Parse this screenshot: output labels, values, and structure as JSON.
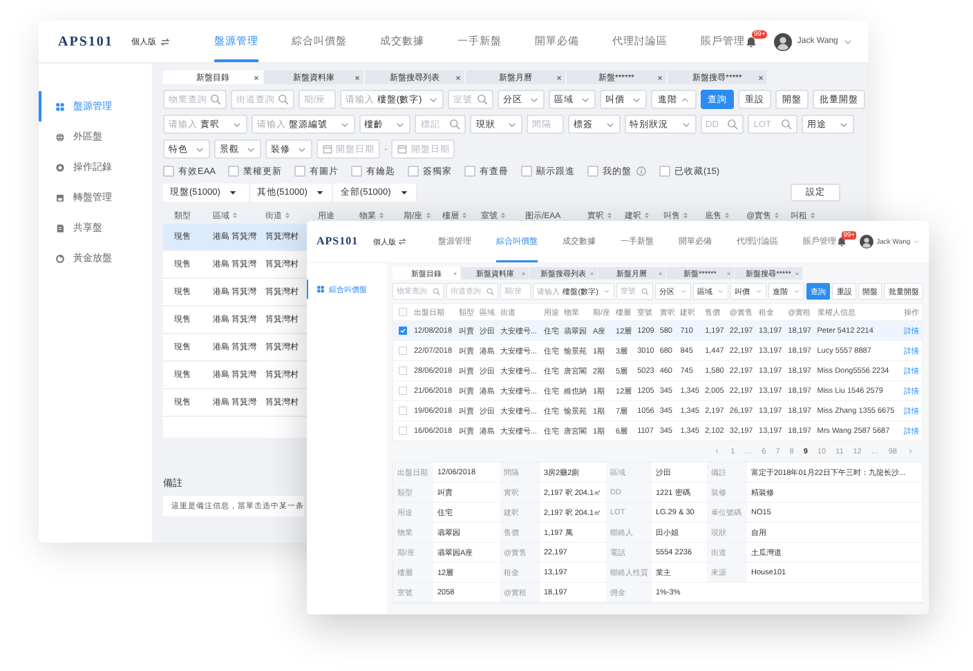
{
  "back_window": {
    "logo": "APS101",
    "edition": "個人版",
    "nav": [
      {
        "label": "盤源管理",
        "selected": true
      },
      {
        "label": "綜合叫價盤",
        "selected": false
      },
      {
        "label": "成交數據",
        "selected": false
      },
      {
        "label": "一手新盤",
        "selected": false
      },
      {
        "label": "開單必備",
        "selected": false
      },
      {
        "label": "代理討論區",
        "selected": false
      },
      {
        "label": "賬戶管理",
        "selected": false
      }
    ],
    "notification_badge": "99+",
    "user": "Jack Wang",
    "sidebar": [
      {
        "label": "盤源管理",
        "selected": true
      },
      {
        "label": "外區盤",
        "selected": false
      },
      {
        "label": "操作記錄",
        "selected": false
      },
      {
        "label": "轉盤管理",
        "selected": false
      },
      {
        "label": "共享盤",
        "selected": false
      },
      {
        "label": "黃金放盤",
        "selected": false
      }
    ],
    "tabs": [
      {
        "label": "新盤目錄",
        "selected": true
      },
      {
        "label": "新盤資料庫",
        "selected": false
      },
      {
        "label": "新盤搜尋列表",
        "selected": false
      },
      {
        "label": "新盤月曆",
        "selected": false
      },
      {
        "label": "新盤******",
        "selected": false
      },
      {
        "label": "新盤搜尋*****",
        "selected": false
      }
    ],
    "filters": [
      [
        {
          "kind": "search",
          "placeholder": "物業查詢"
        },
        {
          "kind": "search",
          "placeholder": "街道查詢"
        },
        {
          "kind": "input",
          "placeholder": "期/座"
        },
        {
          "kind": "select",
          "prefix": "请输入",
          "value": "樓盤(數字)"
        },
        {
          "kind": "search",
          "placeholder": "室號"
        },
        {
          "kind": "select",
          "value": "分区"
        },
        {
          "kind": "select",
          "value": "區域"
        },
        {
          "kind": "select",
          "value": "叫價"
        },
        {
          "kind": "advanced",
          "label": "進階"
        },
        {
          "kind": "button",
          "label": "查詢",
          "primary": true
        },
        {
          "kind": "button",
          "label": "重設",
          "primary": false
        },
        {
          "kind": "button",
          "label": "開盤",
          "primary": false
        },
        {
          "kind": "button",
          "label": "批量開盤",
          "primary": false
        }
      ],
      [
        {
          "kind": "select",
          "prefix": "请输入",
          "value": "實呎"
        },
        {
          "kind": "select",
          "prefix": "请输入",
          "value": "盤源編號"
        },
        {
          "kind": "select",
          "value": "樓齡"
        },
        {
          "kind": "search",
          "placeholder": "標記"
        },
        {
          "kind": "select",
          "value": "現狀"
        },
        {
          "kind": "input",
          "placeholder": "間隔"
        },
        {
          "kind": "select",
          "value": "標簽"
        },
        {
          "kind": "select",
          "value": "特别狀況"
        },
        {
          "kind": "search",
          "placeholder": "DD"
        },
        {
          "kind": "search",
          "placeholder": "LOT"
        },
        {
          "kind": "select",
          "value": "用途"
        }
      ],
      [
        {
          "kind": "select",
          "value": "特色"
        },
        {
          "kind": "select",
          "value": "景觀"
        },
        {
          "kind": "select",
          "value": "裝修"
        },
        {
          "kind": "date",
          "placeholder": "開盤日期"
        },
        {
          "kind": "separator",
          "text": "-"
        },
        {
          "kind": "date",
          "placeholder": "開盤日期"
        }
      ]
    ],
    "checkboxes": [
      {
        "label": "有效EAA",
        "checked": false
      },
      {
        "label": "業權更新",
        "checked": false
      },
      {
        "label": "有圖片",
        "checked": false
      },
      {
        "label": "有鑰匙",
        "checked": false
      },
      {
        "label": "簽獨家",
        "checked": false
      },
      {
        "label": "有查冊",
        "checked": false
      },
      {
        "label": "顯示跟進",
        "checked": false
      },
      {
        "label": "我的盤",
        "checked": false,
        "info": true
      },
      {
        "label": "已收藏(15)",
        "checked": false
      }
    ],
    "segments": [
      "現盤(51000)",
      "其他(51000)",
      "全部(51000)"
    ],
    "settings_button": "設定",
    "table": {
      "columns": [
        {
          "label": "類型",
          "sortable": false
        },
        {
          "label": "區域",
          "sortable": true
        },
        {
          "label": "街道",
          "sortable": true
        },
        {
          "label": "用途",
          "sortable": false
        },
        {
          "label": "物業",
          "sortable": true
        },
        {
          "label": "期/座",
          "sortable": true
        },
        {
          "label": "樓層",
          "sortable": true
        },
        {
          "label": "室號",
          "sortable": true
        },
        {
          "label": "图示/EAA",
          "sortable": false
        },
        {
          "label": "實呎",
          "sortable": true
        },
        {
          "label": "建呎",
          "sortable": true
        },
        {
          "label": "叫售",
          "sortable": true
        },
        {
          "label": "底售",
          "sortable": true
        },
        {
          "label": "@實售",
          "sortable": true
        },
        {
          "label": "叫租",
          "sortable": true
        }
      ],
      "rows": [
        {
          "selected": true,
          "cells": [
            "現售",
            "港島 筲箕灣",
            "筲箕灣村"
          ]
        },
        {
          "selected": false,
          "cells": [
            "現售",
            "港島 筲箕灣",
            "筲箕灣村"
          ]
        },
        {
          "selected": false,
          "cells": [
            "現售",
            "港島 筲箕灣",
            "筲箕灣村"
          ]
        },
        {
          "selected": false,
          "cells": [
            "現售",
            "港島 筲箕灣",
            "筲箕灣村"
          ]
        },
        {
          "selected": false,
          "cells": [
            "現售",
            "港島 筲箕灣",
            "筲箕灣村"
          ]
        },
        {
          "selected": false,
          "cells": [
            "現售",
            "港島 筲箕灣",
            "筲箕灣村"
          ]
        },
        {
          "selected": false,
          "cells": [
            "現售",
            "港島 筲箕灣",
            "筲箕灣村"
          ]
        }
      ]
    },
    "note": {
      "title": "備註",
      "text": "這里是備注信息，當單击选中某一条"
    }
  },
  "front_window": {
    "logo": "APS101",
    "edition": "個人版",
    "nav": [
      {
        "label": "盤源管理",
        "selected": false
      },
      {
        "label": "綜合叫價盤",
        "selected": true
      },
      {
        "label": "成交數據",
        "selected": false
      },
      {
        "label": "一手新盤",
        "selected": false
      },
      {
        "label": "開單必備",
        "selected": false
      },
      {
        "label": "代理討論區",
        "selected": false
      },
      {
        "label": "賬戶管理",
        "selected": false
      }
    ],
    "notification_badge": "99+",
    "user": "Jack Wang",
    "sidebar": [
      {
        "label": "綜合叫價盤",
        "selected": true
      }
    ],
    "tabs": [
      {
        "label": "新盤目錄",
        "selected": true
      },
      {
        "label": "新盤資料庫",
        "selected": false
      },
      {
        "label": "新盤搜尋列表",
        "selected": false
      },
      {
        "label": "新盤月曆",
        "selected": false
      },
      {
        "label": "新盤******",
        "selected": false
      },
      {
        "label": "新盤搜尋*****",
        "selected": false
      }
    ],
    "filters": [
      [
        {
          "kind": "search",
          "placeholder": "物業查詢"
        },
        {
          "kind": "search",
          "placeholder": "街道查詢"
        },
        {
          "kind": "input",
          "placeholder": "期/座"
        },
        {
          "kind": "select",
          "prefix": "请输入",
          "value": "樓盤(數字)"
        },
        {
          "kind": "search",
          "placeholder": "室號"
        },
        {
          "kind": "select",
          "value": "分区"
        },
        {
          "kind": "select",
          "value": "區域"
        },
        {
          "kind": "select",
          "value": "叫價"
        },
        {
          "kind": "select",
          "value": "進階"
        },
        {
          "kind": "button",
          "label": "查詢",
          "primary": true
        },
        {
          "kind": "button",
          "label": "重設",
          "primary": false
        },
        {
          "kind": "button",
          "label": "開盤",
          "primary": false
        },
        {
          "kind": "button",
          "label": "批量開盤",
          "primary": false
        }
      ]
    ],
    "table": {
      "select_all": {
        "checked": false
      },
      "columns": [
        "出盤日期",
        "類型",
        "區域",
        "街道",
        "用途",
        "物業",
        "期/座",
        "樓層",
        "室號",
        "實呎",
        "建呎",
        "售價",
        "@實售",
        "租金",
        "@實租",
        "業權人信息",
        "操作"
      ],
      "rows": [
        {
          "checked": true,
          "cells": [
            "12/08/2018",
            "叫賣",
            "沙田",
            "大安樓号...",
            "住宅",
            "翡翠园",
            "A座",
            "12層",
            "1209",
            "580",
            "710",
            "1,197",
            "22,197",
            "13,197",
            "18,197",
            "Peter  5412 2214"
          ],
          "action": "詳情"
        },
        {
          "checked": false,
          "cells": [
            "22/07/2018",
            "叫賣",
            "港島",
            "大安樓号...",
            "住宅",
            "愉景苑",
            "1期",
            "3層",
            "3010",
            "680",
            "845",
            "1,447",
            "22,197",
            "13,197",
            "18,197",
            "Lucy  5557 8887"
          ],
          "action": "詳情"
        },
        {
          "checked": false,
          "cells": [
            "28/06/2018",
            "叫賣",
            "沙田",
            "大安樓号...",
            "住宅",
            "唐宮閣",
            "2期",
            "5層",
            "5023",
            "460",
            "745",
            "1,580",
            "22,197",
            "13,197",
            "18,197",
            "Miss Dong5556 2234"
          ],
          "action": "詳情"
        },
        {
          "checked": false,
          "cells": [
            "21/06/2018",
            "叫賣",
            "港島",
            "大安樓号...",
            "住宅",
            "維也納",
            "1期",
            "12層",
            "1205",
            "345",
            "1,345",
            "2,005",
            "22,197",
            "13,197",
            "18,197",
            "Miss Liu  1546 2579"
          ],
          "action": "詳情"
        },
        {
          "checked": false,
          "cells": [
            "19/06/2018",
            "叫賣",
            "沙田",
            "大安樓号...",
            "住宅",
            "愉景苑",
            "1期",
            "7層",
            "1056",
            "345",
            "1,345",
            "2,197",
            "26,197",
            "13,197",
            "18,197",
            "Miss Zhang 1355 6675"
          ],
          "action": "詳情"
        },
        {
          "checked": false,
          "cells": [
            "16/06/2018",
            "叫賣",
            "港島",
            "大安樓号...",
            "住宅",
            "唐宮閣",
            "1期",
            "6層",
            "1107",
            "345",
            "1,345",
            "2,102",
            "32,197",
            "13,197",
            "18,197",
            "Mrs Wang  2587 5687"
          ],
          "action": "詳情"
        }
      ]
    },
    "pagination": [
      {
        "label": "1",
        "selected": false
      },
      {
        "label": "…",
        "selected": false
      },
      {
        "label": "6",
        "selected": false
      },
      {
        "label": "7",
        "selected": false
      },
      {
        "label": "8",
        "selected": false
      },
      {
        "label": "9",
        "selected": true
      },
      {
        "label": "10",
        "selected": false
      },
      {
        "label": "11",
        "selected": false
      },
      {
        "label": "12",
        "selected": false
      },
      {
        "label": "…",
        "selected": false
      },
      {
        "label": "98",
        "selected": false
      }
    ],
    "details": [
      [
        {
          "label": "出盤日期",
          "value": "12/06/2018"
        },
        {
          "label": "間隔",
          "value": "3房2廳2廁"
        },
        {
          "label": "區域",
          "value": "沙田"
        },
        {
          "label": "備註",
          "value": "富定于2018年01月22日下午三时：九龍长沙..."
        }
      ],
      [
        {
          "label": "類型",
          "value": "叫賣"
        },
        {
          "label": "實呎",
          "value": "2,197 呎   204.1㎡"
        },
        {
          "label": "DD",
          "value": "1221 密碼"
        },
        {
          "label": "裝修",
          "value": "精裝修"
        }
      ],
      [
        {
          "label": "用途",
          "value": "住宅"
        },
        {
          "label": "建呎",
          "value": "2,197 呎   204.1㎡"
        },
        {
          "label": "LOT",
          "value": "LG.29 & 30"
        },
        {
          "label": "車位號碼",
          "value": "NO15"
        }
      ],
      [
        {
          "label": "物業",
          "value": "翡翠园"
        },
        {
          "label": "售價",
          "value": "1,197 萬"
        },
        {
          "label": "聯絡人",
          "value": "田小姐"
        },
        {
          "label": "現狀",
          "value": "自用"
        }
      ],
      [
        {
          "label": "期/座",
          "value": "翡翠园A座"
        },
        {
          "label": "@實售",
          "value": "22,197"
        },
        {
          "label": "電話",
          "value": "5554 2236"
        },
        {
          "label": "街道",
          "value": "土瓜灣道"
        }
      ],
      [
        {
          "label": "樓層",
          "value": "12層"
        },
        {
          "label": "租金",
          "value": "13,197"
        },
        {
          "label": "聯絡人性質",
          "value": "業主"
        },
        {
          "label": "來源",
          "value": "House101"
        }
      ],
      [
        {
          "label": "室號",
          "value": "2058"
        },
        {
          "label": "@實租",
          "value": "18,197"
        },
        {
          "label": "佣金",
          "value": "1%-3%"
        }
      ]
    ]
  }
}
